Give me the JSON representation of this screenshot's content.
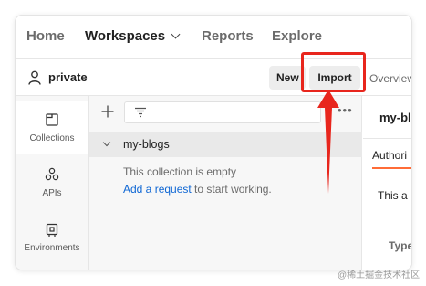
{
  "topnav": {
    "home": "Home",
    "workspaces": "Workspaces",
    "reports": "Reports",
    "explore": "Explore"
  },
  "workspace": {
    "name": "private",
    "new_label": "New",
    "import_label": "Import",
    "overview_tab": "Overview"
  },
  "rail": {
    "items": [
      {
        "label": "Collections",
        "icon": "collections-icon",
        "active": true
      },
      {
        "label": "APIs",
        "icon": "apis-icon",
        "active": false
      },
      {
        "label": "Environments",
        "icon": "environments-icon",
        "active": false
      }
    ]
  },
  "sidebar": {
    "more": "•••",
    "collection_name": "my-blogs",
    "empty_text": "This collection is empty",
    "add_link": "Add a request",
    "add_suffix": " to start working."
  },
  "right_panel": {
    "title": "my-bl",
    "tab": "Authori",
    "desc": "This a",
    "type_label": "Type"
  },
  "annotation": {
    "color": "#e8261d"
  },
  "accent": "#ff6c37",
  "link_color": "#0f67d4",
  "watermark": "@稀土掘金技术社区"
}
